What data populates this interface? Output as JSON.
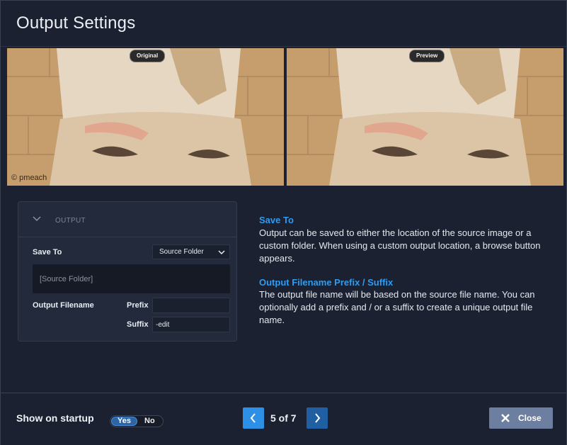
{
  "dialog": {
    "title": "Output Settings"
  },
  "previews": {
    "original_label": "Original",
    "preview_label": "Preview",
    "watermark": "© pmeach"
  },
  "panel": {
    "section_title": "OUTPUT",
    "save_to_label": "Save To",
    "save_to_value": "Source Folder",
    "path_value": "[Source Folder]",
    "output_filename_label": "Output Filename",
    "prefix_label": "Prefix",
    "prefix_value": "",
    "suffix_label": "Suffix",
    "suffix_value": "-edit"
  },
  "help": {
    "save_to_heading": "Save To",
    "save_to_text": "Output can be saved to either the location of the source image or a custom folder. When using a custom output location, a browse button appears.",
    "filename_heading": "Output Filename Prefix / Suffix",
    "filename_text": "The output file name will be based on the source file name. You can optionally add a prefix and / or a suffix to create a unique output file name."
  },
  "footer": {
    "show_on_startup_label": "Show on startup",
    "toggle_yes": "Yes",
    "toggle_no": "No",
    "toggle_selected": "Yes",
    "page_indicator": "5 of 7",
    "close_label": "Close"
  },
  "colors": {
    "accent": "#2f9bf1",
    "background": "#1b2130",
    "panel": "#222a3b",
    "close_button": "#6d7fa0"
  },
  "icons": {
    "collapse": "chevron-down-icon",
    "select": "chevron-down-icon",
    "prev": "chevron-left-icon",
    "next": "chevron-right-icon",
    "close": "close-icon"
  }
}
